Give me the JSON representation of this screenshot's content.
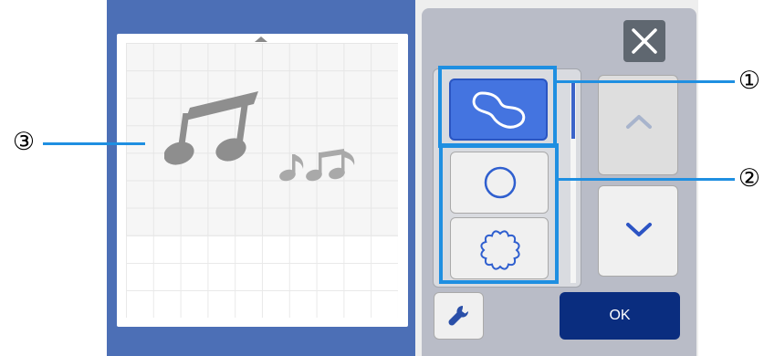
{
  "window": {
    "close_icon": "close-x-icon"
  },
  "mat": {
    "top_marker_icon": "mat-top-arrow-icon",
    "shapes": [
      {
        "name": "beamed-eighth-notes-large",
        "icon": "music-notes-icon",
        "color": "#8e8e8e"
      },
      {
        "name": "beamed-eighth-notes-small",
        "icon": "music-notes-icon",
        "color": "#a9a9a9"
      }
    ]
  },
  "shape_list": {
    "items": [
      {
        "icon": "freeform-outline-icon",
        "selected": true
      },
      {
        "icon": "circle-outline-icon",
        "selected": false
      },
      {
        "icon": "scalloped-circle-outline-icon",
        "selected": false
      }
    ],
    "scroll_up_icon": "chevron-up-icon",
    "scroll_down_icon": "chevron-down-icon"
  },
  "toolbar": {
    "settings_icon": "wrench-icon",
    "ok_label": "OK"
  },
  "callouts": {
    "one": "①",
    "two": "②",
    "three": "③"
  },
  "colors": {
    "accent_blue": "#4474e0",
    "highlight_blue": "#1f8fe1",
    "ok_navy": "#0a2d7f",
    "screen_bg": "#4c6fb6"
  }
}
